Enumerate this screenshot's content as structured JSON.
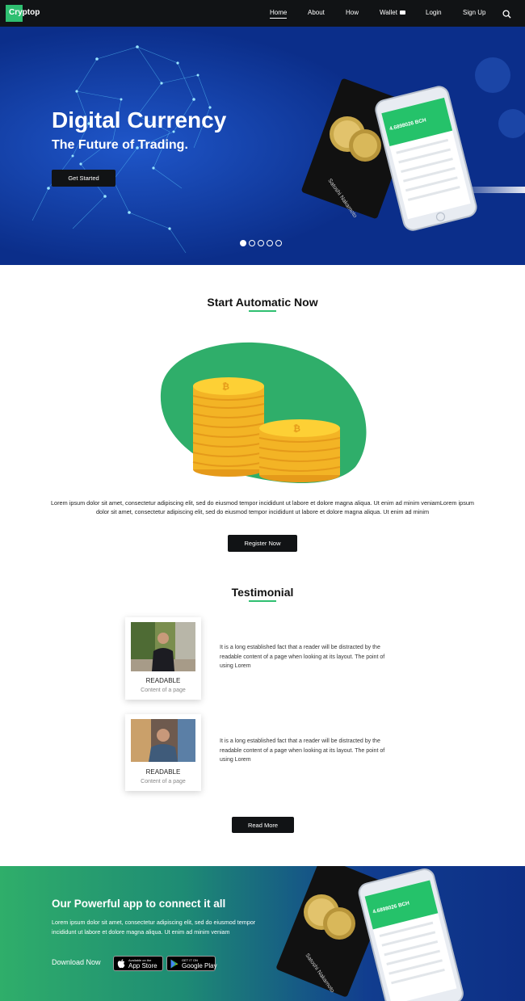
{
  "nav": {
    "brand": "Cryptop",
    "items": [
      {
        "label": "Home",
        "active": true
      },
      {
        "label": "About"
      },
      {
        "label": "How"
      },
      {
        "label": "Wallet"
      },
      {
        "label": "Login"
      },
      {
        "label": "Sign Up"
      }
    ]
  },
  "hero": {
    "title": "Digital Currency",
    "subtitle": "The Future of Trading.",
    "button": "Get Started",
    "slides": 5,
    "active_slide": 1,
    "card_text": "Satoshi Nakamoto",
    "phone_balance": "4.6898026 BCH"
  },
  "automatic": {
    "title": "Start Automatic Now",
    "text": "Lorem ipsum dolor sit amet, consectetur adipiscing elit, sed do eiusmod tempor incididunt ut labore et dolore magna aliqua. Ut enim ad minim veniamLorem ipsum dolor sit amet, consectetur adipiscing elit, sed do eiusmod tempor incididunt ut labore et dolore magna aliqua. Ut enim ad minim",
    "button": "Register Now"
  },
  "testimonial": {
    "title": "Testimonial",
    "items": [
      {
        "name": "READABLE",
        "role": "Content of a page",
        "text": "It is a long established fact that a reader will be distracted by the readable content of a page when looking at its layout. The point of using Lorem"
      },
      {
        "name": "READABLE",
        "role": "Content of a page",
        "text": "It is a long established fact that a reader will be distracted by the readable content of a page when looking at its layout. The point of using Lorem"
      }
    ],
    "button": "Read More"
  },
  "app": {
    "title": "Our Powerful app to connect it all",
    "text": "Lorem ipsum dolor sit amet, consectetur adipiscing elit, sed do eiusmod tempor incididunt ut labore et dolore magna aliqua. Ut enim ad minim veniam",
    "download_label": "Download Now",
    "app_store": {
      "small": "Available on the",
      "big": "App Store"
    },
    "google_play": {
      "small": "GET IT ON",
      "big": "Google Play"
    },
    "card_text": "Satoshi Nakamoto",
    "phone_balance": "4.6898026 BCH"
  },
  "colors": {
    "accent": "#2fbf71",
    "nav_bg": "#111315",
    "hero_bg": "#0b2e8a",
    "button_bg": "#111315"
  },
  "icons": [
    "search-icon",
    "wallet-icon",
    "apple-icon",
    "play-icon",
    "bitcoin-icon"
  ]
}
